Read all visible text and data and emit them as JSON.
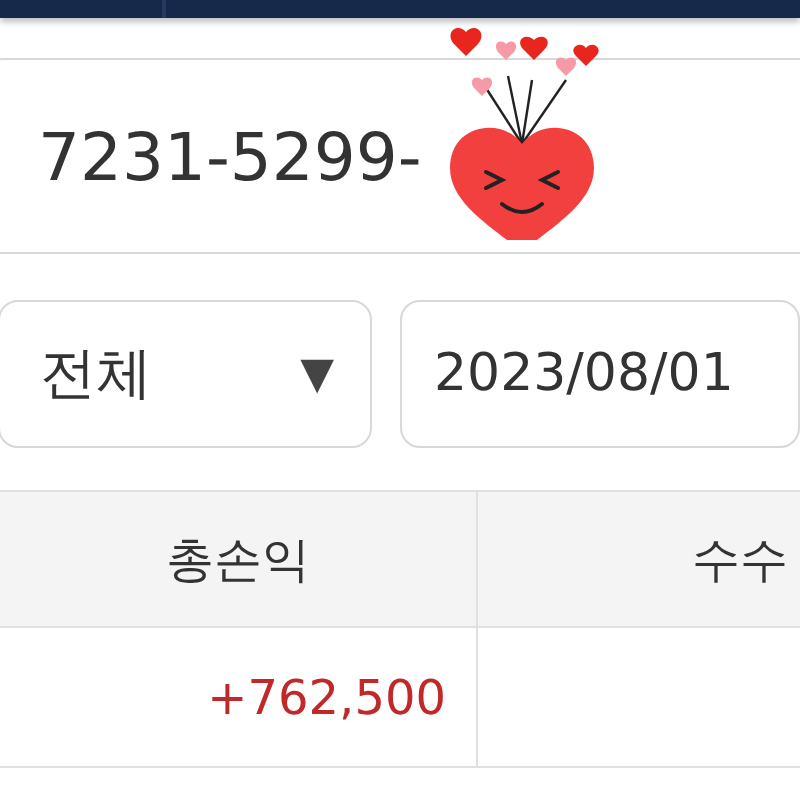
{
  "account_field": {
    "value": "7231-5299-"
  },
  "period_dropdown": {
    "value": "전체",
    "arrow": "▼"
  },
  "date_field": {
    "value": "2023/08/01"
  },
  "table": {
    "columns": [
      "총손익",
      "수수"
    ],
    "rows": [
      {
        "total_pnl": "+762,500"
      }
    ]
  }
}
